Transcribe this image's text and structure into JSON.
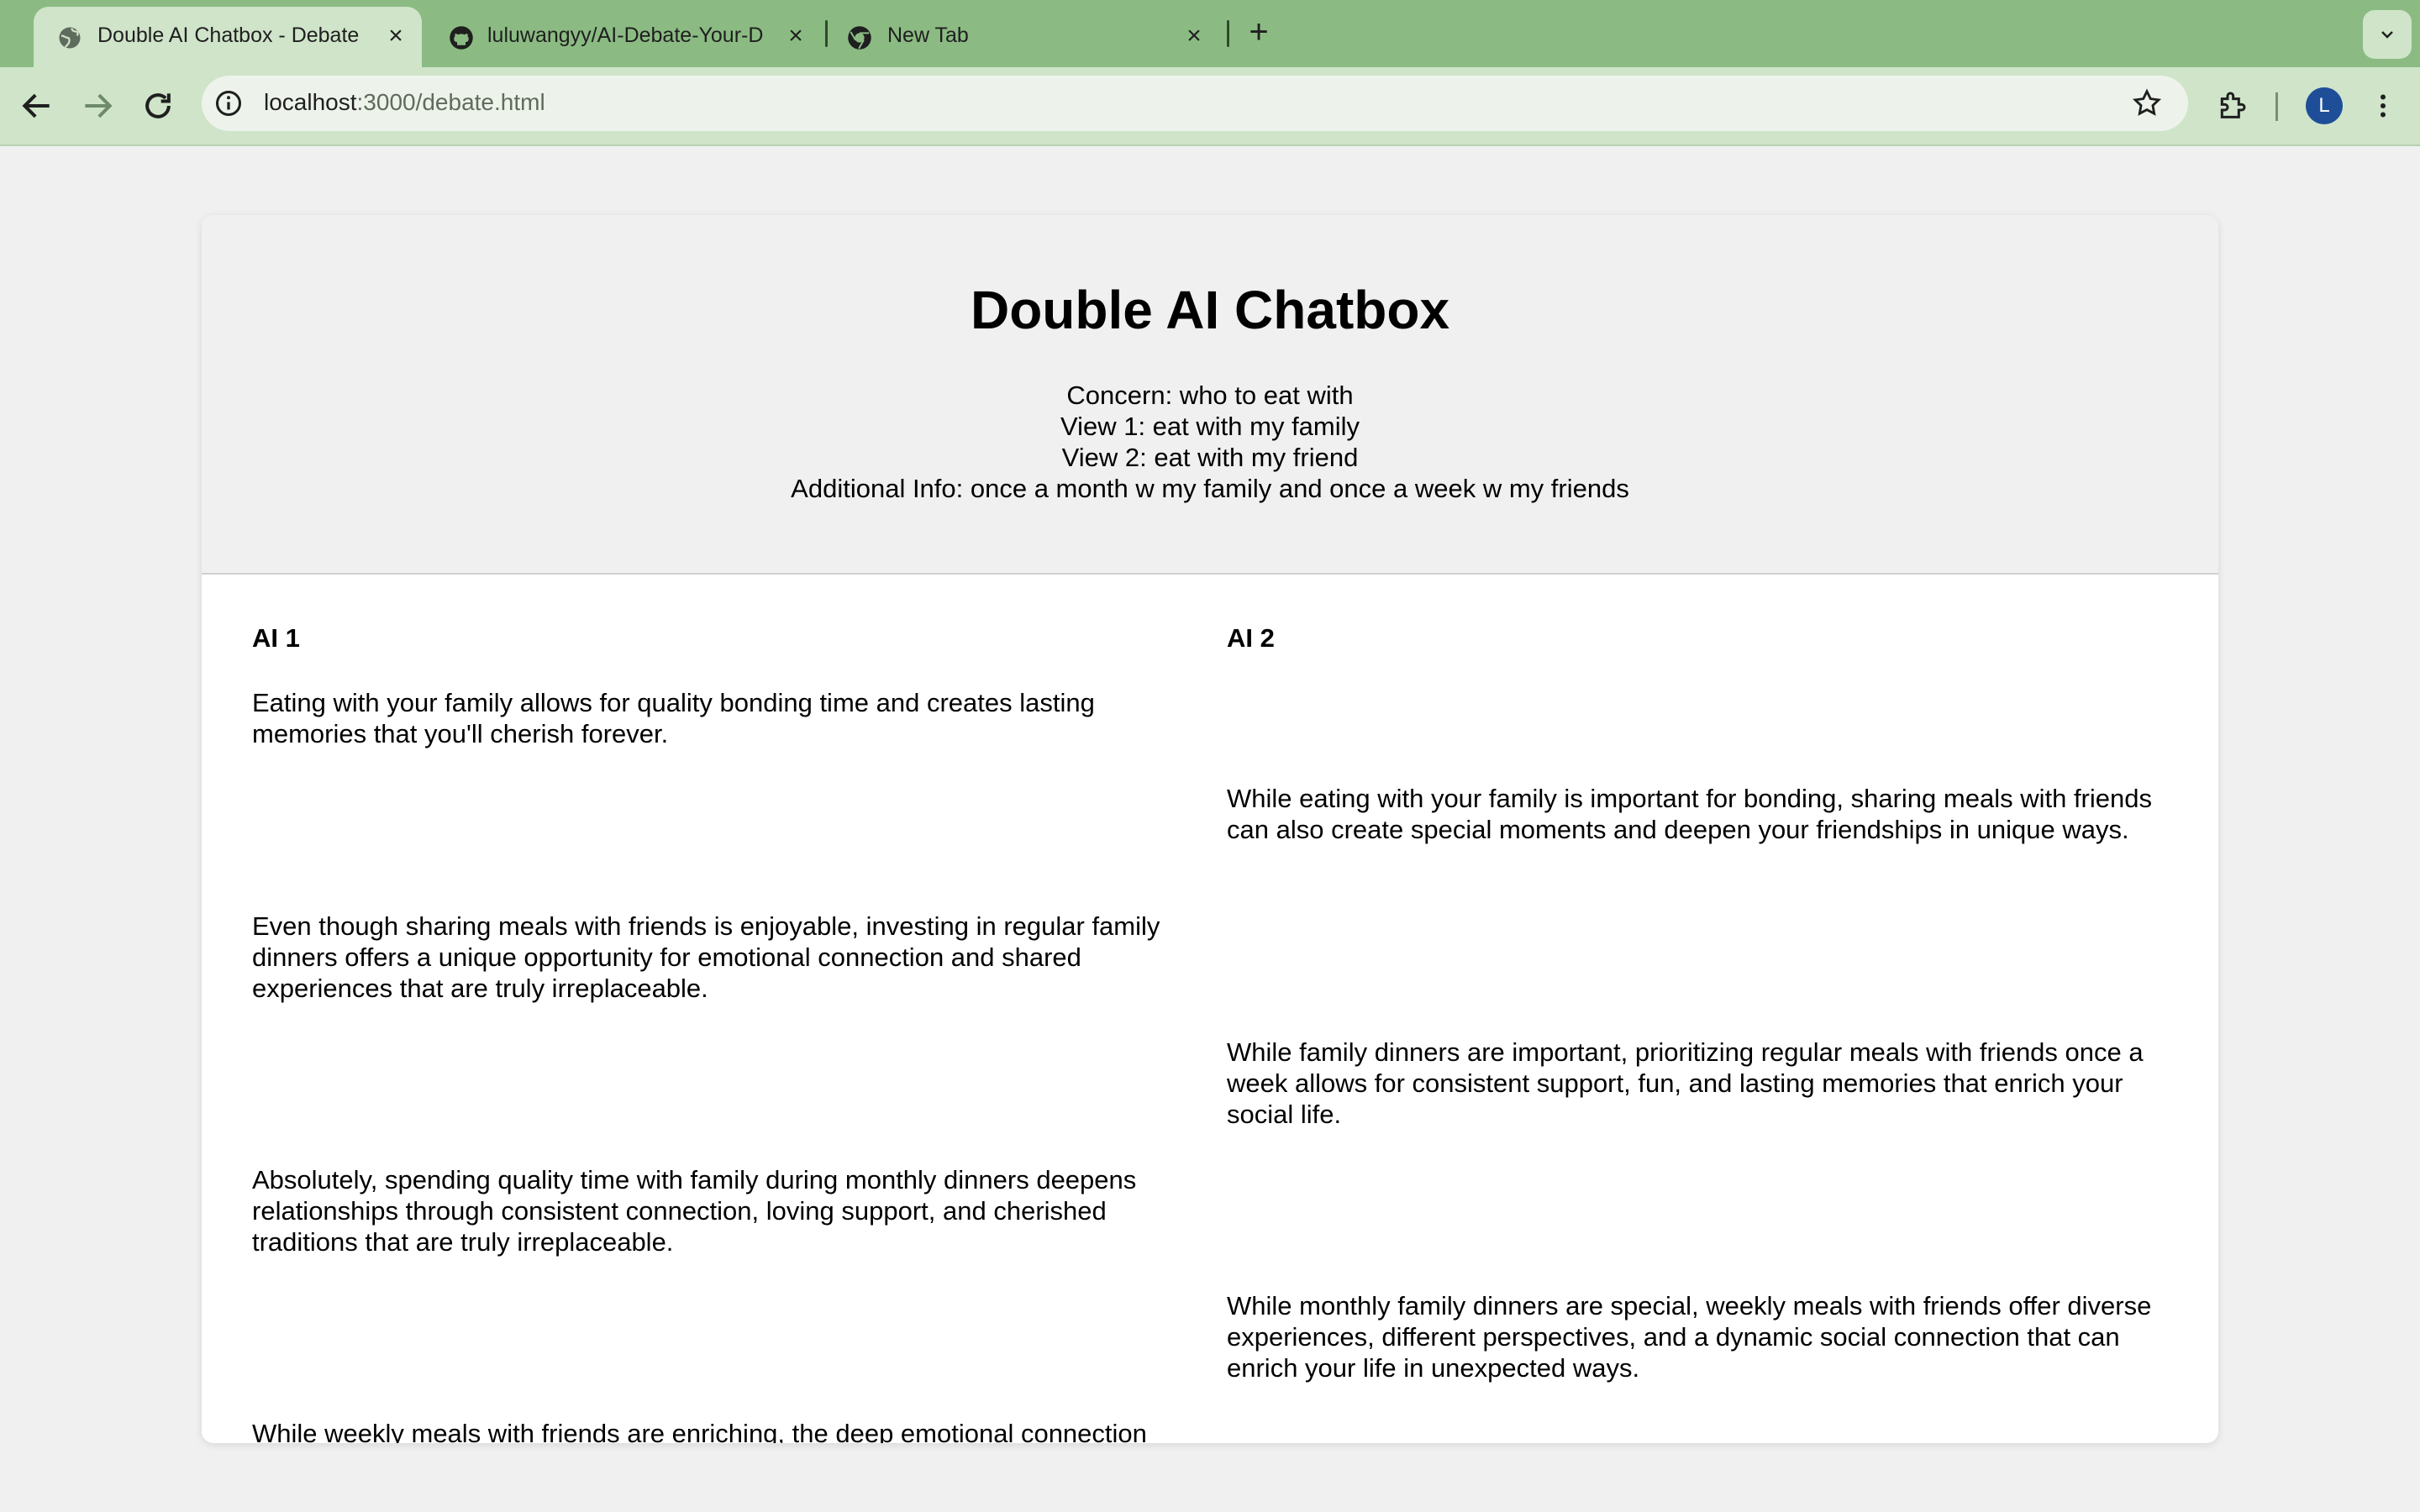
{
  "browser": {
    "tabs": [
      {
        "title": "Double AI Chatbox - Debate",
        "active": true,
        "icon": "globe-icon"
      },
      {
        "title": "luluwangyy/AI-Debate-Your-D",
        "active": false,
        "icon": "github-icon"
      },
      {
        "title": "New Tab",
        "active": false,
        "icon": "chrome-icon"
      }
    ],
    "url_host": "localhost",
    "url_path": ":3000/debate.html",
    "profile_initial": "L",
    "accent_color": "#8bbb83",
    "toolbar_color": "#cfe4c9",
    "profile_color": "#1f4e99"
  },
  "page": {
    "title": "Double AI Chatbox",
    "concern": "Concern: who to eat with",
    "view1": "View 1: eat with my family",
    "view2": "View 2: eat with my friend",
    "additional_info": "Additional Info: once a month w my family and once a week w my friends",
    "ai1_label": "AI 1",
    "ai2_label": "AI 2",
    "messages": [
      {
        "speaker": "AI 1",
        "text": "Eating with your family allows for quality bonding time and creates lasting memories that you'll cherish forever."
      },
      {
        "speaker": "AI 2",
        "text": "While eating with your family is important for bonding, sharing meals with friends can also create special moments and deepen your friendships in unique ways."
      },
      {
        "speaker": "AI 1",
        "text": "Even though sharing meals with friends is enjoyable, investing in regular family dinners offers a unique opportunity for emotional connection and shared experiences that are truly irreplaceable."
      },
      {
        "speaker": "AI 2",
        "text": "While family dinners are important, prioritizing regular meals with friends once a week allows for consistent support, fun, and lasting memories that enrich your social life."
      },
      {
        "speaker": "AI 1",
        "text": "Absolutely, spending quality time with family during monthly dinners deepens relationships through consistent connection, loving support, and cherished traditions that are truly irreplaceable."
      },
      {
        "speaker": "AI 2",
        "text": "While monthly family dinners are special, weekly meals with friends offer diverse experiences, different perspectives, and a dynamic social connection that can enrich your life in unexpected ways."
      },
      {
        "speaker": "AI 1",
        "text": "While weekly meals with friends are enriching, the deep emotional connection"
      }
    ]
  }
}
